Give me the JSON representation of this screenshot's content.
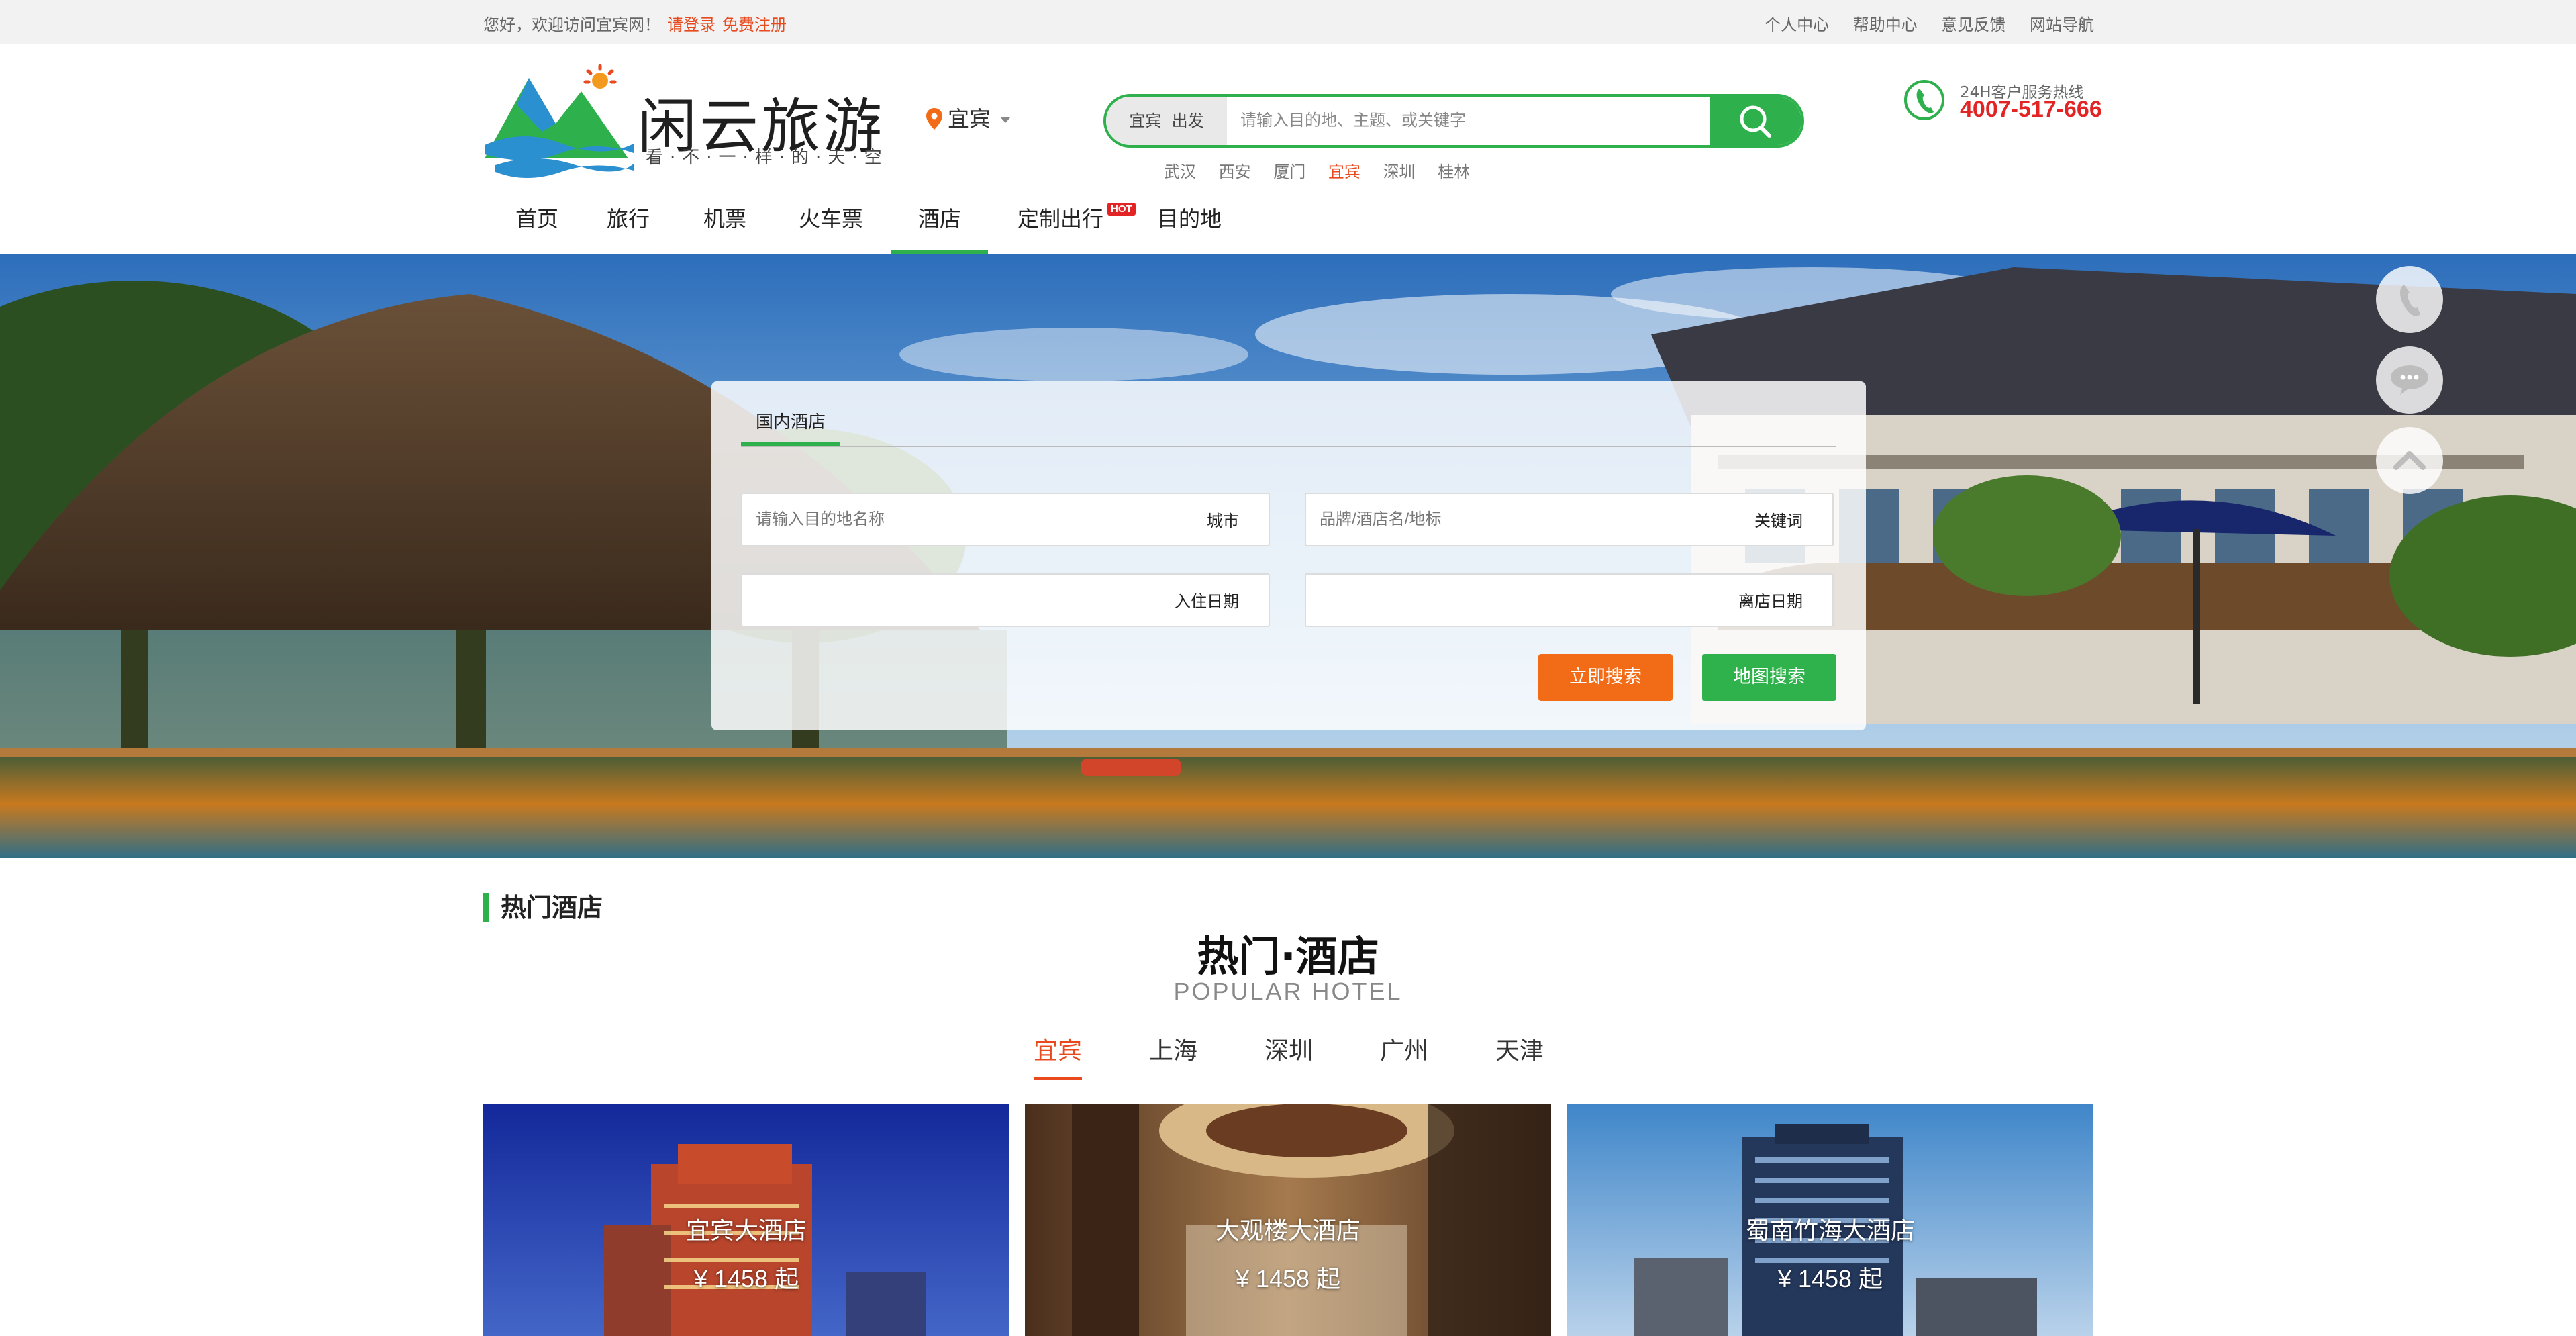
{
  "topbar": {
    "welcome": "您好，欢迎访问宜宾网！",
    "login": "请登录",
    "register": "免费注册",
    "links": [
      "个人中心",
      "帮助中心",
      "意见反馈",
      "网站导航"
    ]
  },
  "header": {
    "brand_name": "闲云旅游",
    "slogan": "看·不·一·样·的·天·空",
    "current_city": "宜宾",
    "search": {
      "scope_city": "宜宾",
      "scope_type": "出发",
      "placeholder": "请输入目的地、主题、或关键字"
    },
    "hot_cities": [
      "武汉",
      "西安",
      "厦门",
      "宜宾",
      "深圳",
      "桂林"
    ],
    "hot_cities_active": "宜宾",
    "hotline_label": "24H客户服务热线",
    "hotline_number": "4007-517-666"
  },
  "nav": {
    "items": [
      "首页",
      "旅行",
      "机票",
      "火车票",
      "酒店",
      "定制出行",
      "目的地"
    ],
    "active": "酒店",
    "hot_badge": "HOT"
  },
  "hotel_search": {
    "tab": "国内酒店",
    "dest_placeholder": "请输入目的地名称",
    "dest_tag": "城市",
    "keyword_placeholder": "品牌/酒店名/地标",
    "keyword_tag": "关键词",
    "checkin_tag": "入住日期",
    "checkout_tag": "离店日期",
    "search_btn": "立即搜索",
    "map_btn": "地图搜索"
  },
  "popular": {
    "section_title": "热门酒店",
    "title": "热门·酒店",
    "subtitle": "POPULAR   HOTEL",
    "city_tabs": [
      "宜宾",
      "上海",
      "深圳",
      "广州",
      "天津"
    ],
    "active_tab": "宜宾",
    "hotels": [
      {
        "name": "宜宾大酒店",
        "price": "¥ 1458 起"
      },
      {
        "name": "大观楼大酒店",
        "price": "¥ 1458 起"
      },
      {
        "name": "蜀南竹海大酒店",
        "price": "¥ 1458 起"
      }
    ]
  },
  "colors": {
    "brand_green": "#2eb14c",
    "accent_orange": "#f26b17",
    "hotline_red": "#e32424"
  }
}
